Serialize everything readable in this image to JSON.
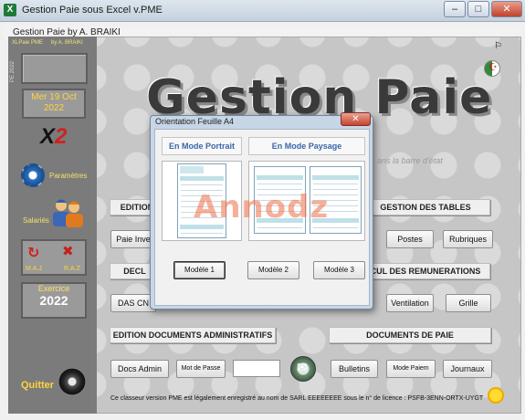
{
  "window": {
    "title": "Gestion Paie sous Excel v.PME",
    "icon": "X",
    "btn_min": "–",
    "btn_max": "□",
    "btn_close": "✕"
  },
  "frame": {
    "title": "Gestion Paie by A. BRAIKI",
    "corner_icon": "⚐"
  },
  "sidebar": {
    "small_left": "XLPaie PME",
    "small_right": "by A. BRAIKI",
    "vertical_text": "PE 2022",
    "date": "Mer 19 Oct\n2022",
    "date_line1": "Mer 19 Oct",
    "date_line2": "2022",
    "logo": "X",
    "logo_accent": "2",
    "parametres": "Paramètres",
    "salaries": "Salariés",
    "maj": "M.A.J",
    "raz": "R.A.Z",
    "exercice_label": "Exercice",
    "exercice_year": "2022",
    "quitter": "Quitter"
  },
  "main": {
    "big_title": "Gestion Paie",
    "status_hint": "ans la barre d'état",
    "sections": {
      "edition_top": "EDITION",
      "gestion_tables": "GESTION DES TABLES",
      "decl": "DECL",
      "calcul_remunerations": "CUL DES REMUNERATIONS",
      "edition_docs_admin": "EDITION DOCUMENTS ADMINISTRATIFS",
      "documents_paie": "DOCUMENTS DE PAIE"
    },
    "buttons": {
      "paie_inverse": "Paie Inve",
      "postes": "Postes",
      "rubriques": "Rubriques",
      "das_cn": "DAS CN",
      "ventilation": "Ventilation",
      "grille": "Grille",
      "docs_admin": "Docs Admin",
      "mot_de_passe": "Mot de Passe",
      "bulletins": "Bulletins",
      "mode_paiem": "Mode Paiem",
      "journaux": "Journaux"
    },
    "footer": "Ce classeur version PME est légalement enregistré au nom de SARL EEEEEEEE sous le n° de licence : PSFB-3ENN-ORTX-UYGT"
  },
  "dialog": {
    "title": "Orientation Feuille A4",
    "close": "✕",
    "portrait_label": "En Mode Portrait",
    "paysage_label": "En Mode Paysage",
    "watermark_main": "Annodz",
    "buttons": [
      "Modèle 1",
      "Modèle 2",
      "Modèle 3"
    ]
  },
  "colors": {
    "sidebar": "#7b7b7b",
    "accent_yellow": "#ffd43b",
    "dialog_bg": "#c7d6e6",
    "mode_text": "#3a66a8"
  }
}
